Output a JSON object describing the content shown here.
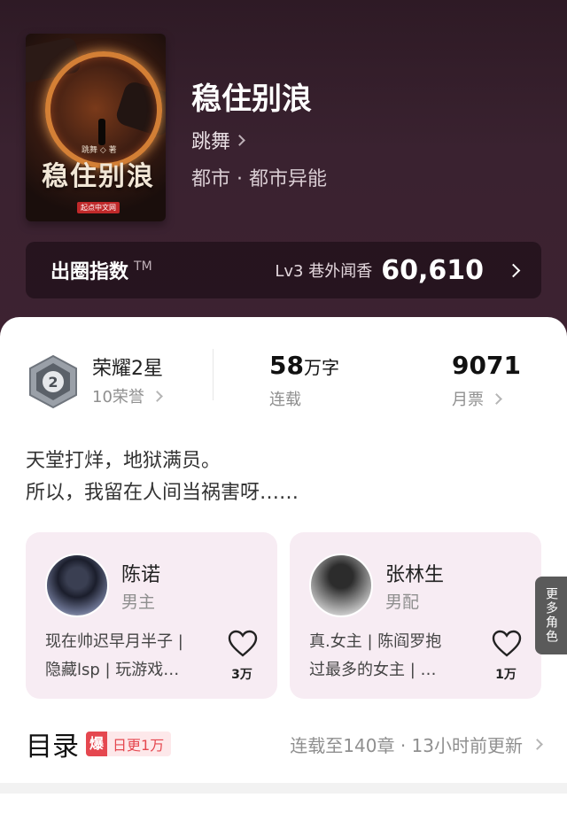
{
  "book": {
    "title": "稳住别浪",
    "author": "跳舞",
    "genre": "都市 · 都市异能",
    "cover": {
      "title": "稳住别浪",
      "author_tag": "跳舞 ◇ 著",
      "publisher": "起点中文网"
    }
  },
  "circle_index": {
    "label": "出圈指数",
    "tm": "TM",
    "level": "Lv3 巷外闻香",
    "value": "60,610"
  },
  "stats": {
    "honor": {
      "title": "荣耀2星",
      "sub": "10荣誉",
      "badge_number": "2"
    },
    "words": {
      "value": "58",
      "unit": "万字",
      "label": "连载"
    },
    "votes": {
      "value": "9071",
      "label": "月票"
    }
  },
  "blurb": {
    "line1": "天堂打烊，地狱满员。",
    "line2": "所以，我留在人间当祸害呀……"
  },
  "characters": [
    {
      "name": "陈诺",
      "role": "男主",
      "desc_line1": "现在帅迟早月半子 |",
      "desc_line2": "隐藏lsp | 玩游戏…",
      "likes": "3万"
    },
    {
      "name": "张林生",
      "role": "男配",
      "desc_line1": "真.女主 | 陈阎罗抱",
      "desc_line2": "过最多的女主 | …",
      "likes": "1万"
    }
  ],
  "more_roles": "更多角色",
  "toc": {
    "title": "目录",
    "hot_icon": "爆",
    "hot_text": "日更1万",
    "status": "连载至140章 · 13小时前更新"
  },
  "colors": {
    "accent": "#e5474f",
    "hero_bg": "#3a2130",
    "card_bg": "#f7ecf3"
  }
}
